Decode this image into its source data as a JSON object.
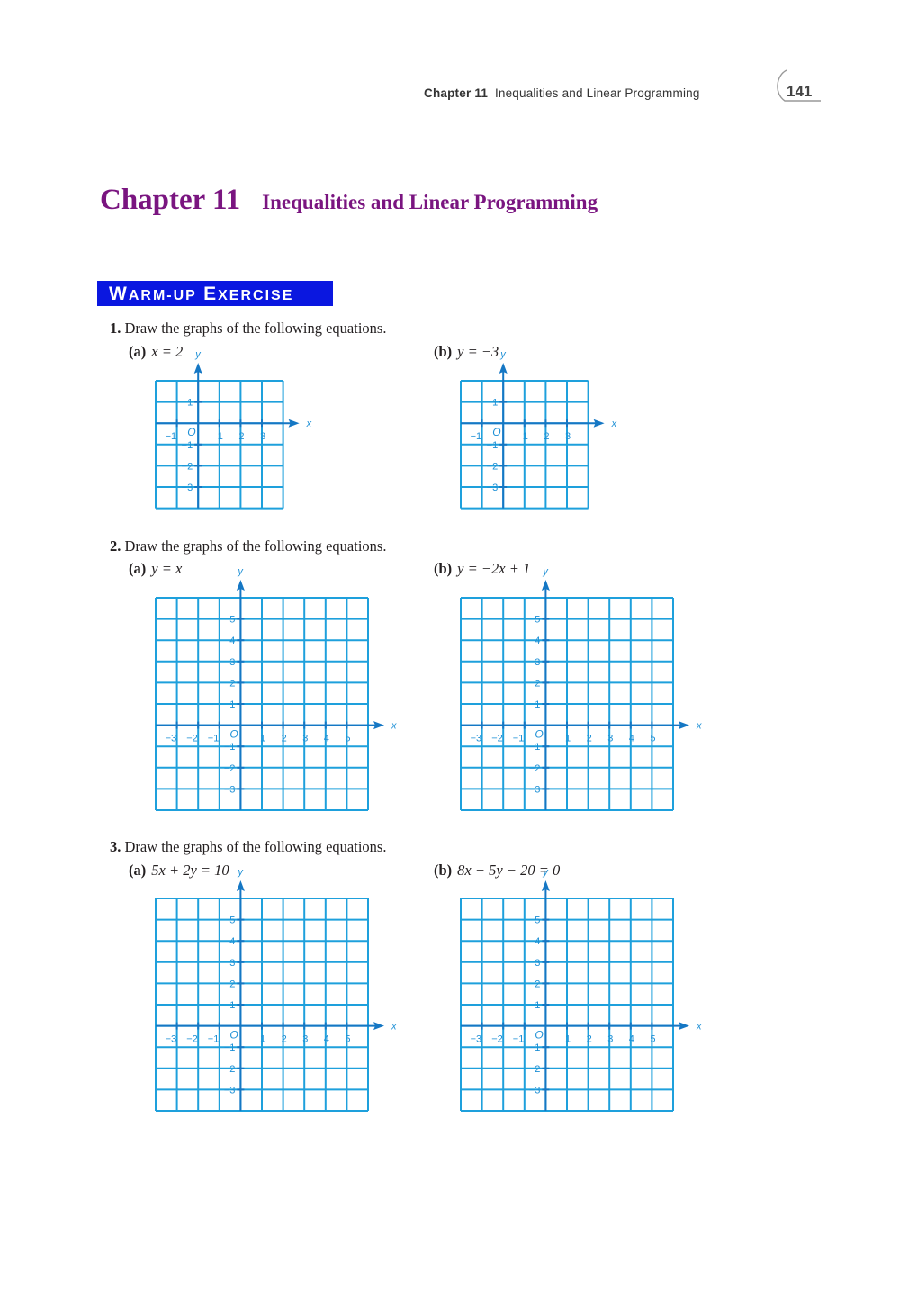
{
  "header": {
    "chapter_label": "Chapter 11",
    "chapter_name": "Inequalities and Linear Programming",
    "page_number": "141"
  },
  "title": {
    "chapter": "Chapter 11",
    "subtitle": "Inequalities and Linear Programming"
  },
  "banner": {
    "w_cap": "W",
    "w_rest": "ARM-UP",
    "e_cap": "E",
    "e_rest": "XERCISE"
  },
  "colors": {
    "title": "#7a1580",
    "banner": "#0a17e0",
    "grid": "#1ea0dc",
    "axis": "#1577c4"
  },
  "questions": [
    {
      "number": "1.",
      "prompt": "Draw the graphs of the following equations.",
      "parts": [
        {
          "label": "(a)",
          "equation": "x = 2"
        },
        {
          "label": "(b)",
          "equation": "y = −3"
        }
      ],
      "grid": {
        "x_min": -2,
        "x_max": 4,
        "y_min": -4,
        "y_max": 2,
        "x_ticks": [
          "−1",
          "1",
          "2",
          "3"
        ],
        "y_ticks": [
          "1",
          "−1",
          "−2",
          "−3"
        ]
      }
    },
    {
      "number": "2.",
      "prompt": "Draw the graphs of the following equations.",
      "parts": [
        {
          "label": "(a)",
          "equation": "y = x"
        },
        {
          "label": "(b)",
          "equation": "y = −2x + 1"
        }
      ],
      "grid": {
        "x_min": -4,
        "x_max": 6,
        "y_min": -4,
        "y_max": 6,
        "x_ticks": [
          "−3",
          "−2",
          "−1",
          "1",
          "2",
          "3",
          "4",
          "5"
        ],
        "y_ticks": [
          "5",
          "4",
          "3",
          "2",
          "1",
          "−1",
          "−2",
          "−3"
        ]
      }
    },
    {
      "number": "3.",
      "prompt": "Draw the graphs of the following equations.",
      "parts": [
        {
          "label": "(a)",
          "equation": "5x + 2y = 10"
        },
        {
          "label": "(b)",
          "equation": "8x − 5y − 20 = 0"
        }
      ],
      "grid": {
        "x_min": -4,
        "x_max": 6,
        "y_min": -4,
        "y_max": 6,
        "x_ticks": [
          "−3",
          "−2",
          "−1",
          "1",
          "2",
          "3",
          "4",
          "5"
        ],
        "y_ticks": [
          "5",
          "4",
          "3",
          "2",
          "1",
          "−1",
          "−2",
          "−3"
        ]
      }
    }
  ],
  "axis_labels": {
    "x": "x",
    "y": "y",
    "origin": "O"
  }
}
